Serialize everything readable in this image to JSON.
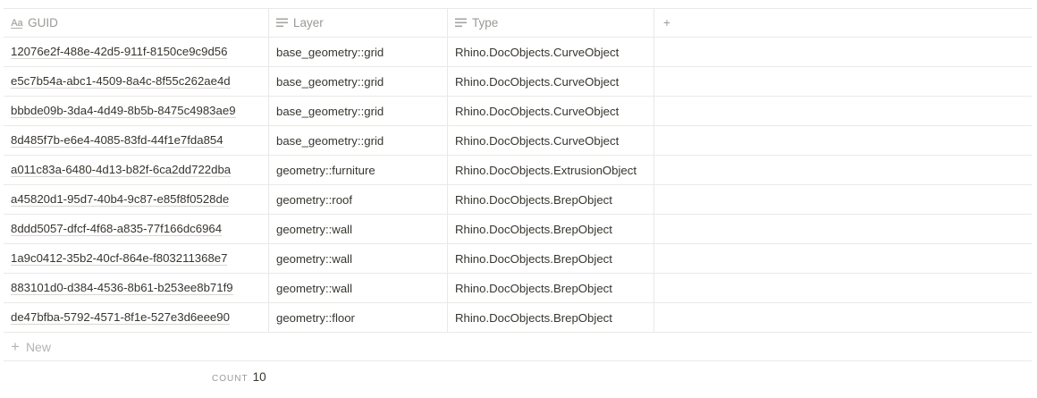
{
  "columns": {
    "guid": {
      "label": "GUID",
      "icon": "title-icon"
    },
    "layer": {
      "label": "Layer",
      "icon": "text-icon"
    },
    "type": {
      "label": "Type",
      "icon": "text-icon"
    },
    "add": {
      "label": "+"
    }
  },
  "rows": [
    {
      "guid": "12076e2f-488e-42d5-911f-8150ce9c9d56",
      "layer": "base_geometry::grid",
      "type": "Rhino.DocObjects.CurveObject"
    },
    {
      "guid": "e5c7b54a-abc1-4509-8a4c-8f55c262ae4d",
      "layer": "base_geometry::grid",
      "type": "Rhino.DocObjects.CurveObject"
    },
    {
      "guid": "bbbde09b-3da4-4d49-8b5b-8475c4983ae9",
      "layer": "base_geometry::grid",
      "type": "Rhino.DocObjects.CurveObject"
    },
    {
      "guid": "8d485f7b-e6e4-4085-83fd-44f1e7fda854",
      "layer": "base_geometry::grid",
      "type": "Rhino.DocObjects.CurveObject"
    },
    {
      "guid": "a011c83a-6480-4d13-b82f-6ca2dd722dba",
      "layer": "geometry::furniture",
      "type": "Rhino.DocObjects.ExtrusionObject"
    },
    {
      "guid": "a45820d1-95d7-40b4-9c87-e85f8f0528de",
      "layer": "geometry::roof",
      "type": "Rhino.DocObjects.BrepObject"
    },
    {
      "guid": "8ddd5057-dfcf-4f68-a835-77f166dc6964",
      "layer": "geometry::wall",
      "type": "Rhino.DocObjects.BrepObject"
    },
    {
      "guid": "1a9c0412-35b2-40cf-864e-f803211368e7",
      "layer": "geometry::wall",
      "type": "Rhino.DocObjects.BrepObject"
    },
    {
      "guid": "883101d0-d384-4536-8b61-b253ee8b71f9",
      "layer": "geometry::wall",
      "type": "Rhino.DocObjects.BrepObject"
    },
    {
      "guid": "de47bfba-5792-4571-8f1e-527e3d6eee90",
      "layer": "geometry::floor",
      "type": "Rhino.DocObjects.BrepObject"
    }
  ],
  "new_row": {
    "label": "New"
  },
  "footer": {
    "count_label": "COUNT",
    "count_value": "10"
  }
}
